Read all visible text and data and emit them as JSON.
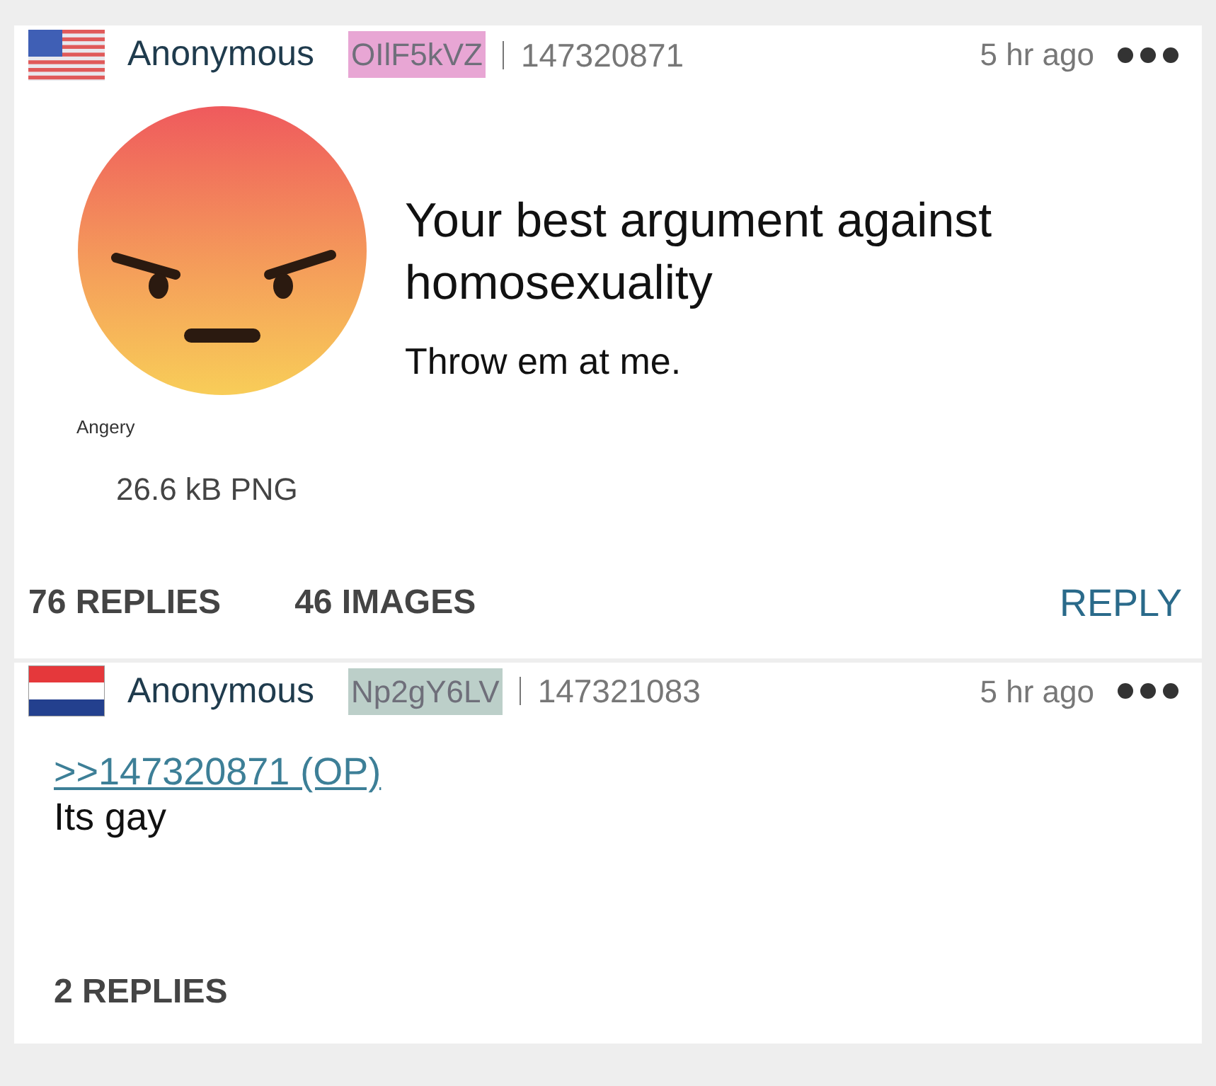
{
  "posts": [
    {
      "flag": {
        "kind": "us"
      },
      "name": "Anonymous",
      "poster_id": {
        "text": "OIlF5kVZ",
        "color": "#e8a6d4"
      },
      "number": "147320871",
      "time": "5 hr ago",
      "image": {
        "filename": "Angery",
        "info": "26.6 kB PNG"
      },
      "subject": "Your best argument against homosexuality",
      "comment": "Throw em at me.",
      "footer": {
        "replies": "76 REPLIES",
        "images": "46 IMAGES",
        "reply_button": "REPLY"
      }
    },
    {
      "flag": {
        "kind": "nl"
      },
      "name": "Anonymous",
      "poster_id": {
        "text": "Np2gY6LV",
        "color": "#bccfc9"
      },
      "number": "147321083",
      "time": "5 hr ago",
      "quote": ">>147320871 (OP)",
      "comment": "Its gay",
      "footer": {
        "replies": "2 REPLIES"
      }
    }
  ]
}
